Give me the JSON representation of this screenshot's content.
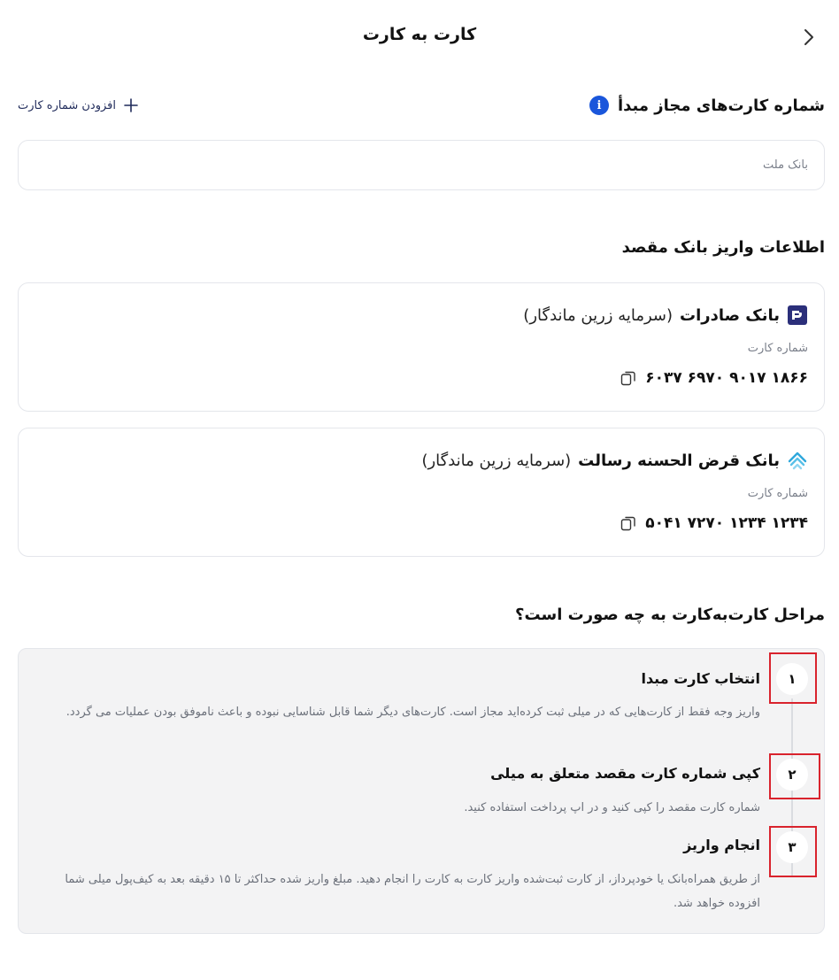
{
  "header": {
    "title": "کارت به کارت",
    "back_icon": "chevron-right-icon"
  },
  "origin": {
    "title": "شماره کارت‌های مجاز مبدأ",
    "info_icon": "info-icon",
    "info_glyph": "i",
    "add_label": "افزودن شماره کارت",
    "selected_bank": "بانک ملت"
  },
  "destination": {
    "title": "اطلاعات واریز بانک مقصد",
    "cards": [
      {
        "bank_name": "بانک صادرات",
        "owner": "(سرمایه زرین ماندگار)",
        "card_label": "شماره کارت",
        "card_number": "۶۰۳۷ ۶۹۷۰ ۹۰۱۷ ۱۸۶۶",
        "logo_icon": "bank-saderat-logo-icon",
        "logo_color": "#2b2f7a"
      },
      {
        "bank_name": "بانک قرض الحسنه رسالت",
        "owner": "(سرمایه زرین ماندگار)",
        "card_label": "شماره کارت",
        "card_number": "۵۰۴۱ ۷۲۷۰ ۱۲۳۴ ۱۲۳۴",
        "logo_icon": "bank-resalat-logo-icon",
        "logo_color": "#2fa8dc"
      }
    ]
  },
  "steps": {
    "title": "مراحل کارت‌به‌کارت به چه صورت است؟",
    "items": [
      {
        "number": "۱",
        "title": "انتخاب کارت مبدا",
        "description": "واریز وجه فقط از کارت‌هایی که در میلی ثبت کرده‌اید مجاز است. کارت‌های دیگر شما قابل شناسایی نبوده و باعث ناموفق بودن عملیات می گردد."
      },
      {
        "number": "۲",
        "title": "کپی شماره کارت مقصد متعلق به میلی",
        "description": "شماره کارت مقصد را کپی کنید و در اپ پرداخت استفاده کنید."
      },
      {
        "number": "۳",
        "title": "انجام واریز",
        "description": "از طریق همراه‌بانک یا خودپرداز، از کارت ثبت‌شده واریز کارت به کارت را انجام دهید. مبلغ واریز شده حداکثر تا ۱۵ دقیقه بعد به کیف‌پول میلی شما افزوده خواهد شد."
      }
    ]
  },
  "colors": {
    "accent": "#1a56db",
    "highlight": "#d9232d",
    "step_bg": "#f3f3f4"
  }
}
